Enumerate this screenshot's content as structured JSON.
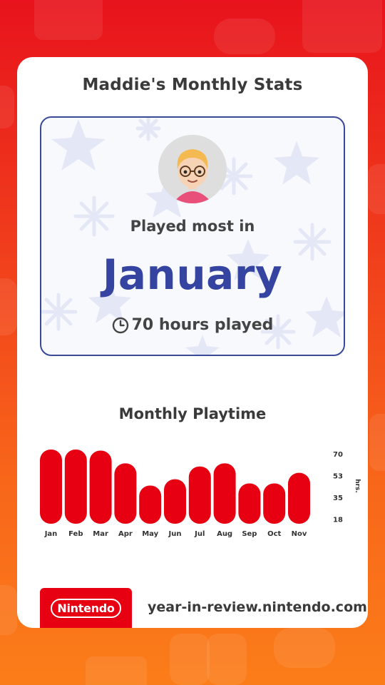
{
  "header": {
    "title": "Maddie's Monthly Stats"
  },
  "hero": {
    "label": "Played most in",
    "month": "January",
    "hours_text": "70 hours played",
    "accent_color": "#3444a0",
    "border_color": "#3a4a9a"
  },
  "chart_section": {
    "title": "Monthly Playtime"
  },
  "chart_data": {
    "type": "bar",
    "categories": [
      "Jan",
      "Feb",
      "Mar",
      "Apr",
      "May",
      "Jun",
      "Jul",
      "Aug",
      "Sep",
      "Oct",
      "Nov"
    ],
    "values": [
      70,
      70,
      69,
      57,
      36,
      42,
      54,
      57,
      38,
      38,
      48
    ],
    "y_ticks": [
      70,
      53,
      35,
      18
    ],
    "ylabel": "hrs.",
    "ylim": [
      0,
      70
    ],
    "bar_color": "#e60012",
    "grid": false,
    "y_axis_side": "right"
  },
  "footer": {
    "brand": "Nintendo",
    "url": "year-in-review.nintendo.com",
    "brand_color": "#e60012"
  }
}
